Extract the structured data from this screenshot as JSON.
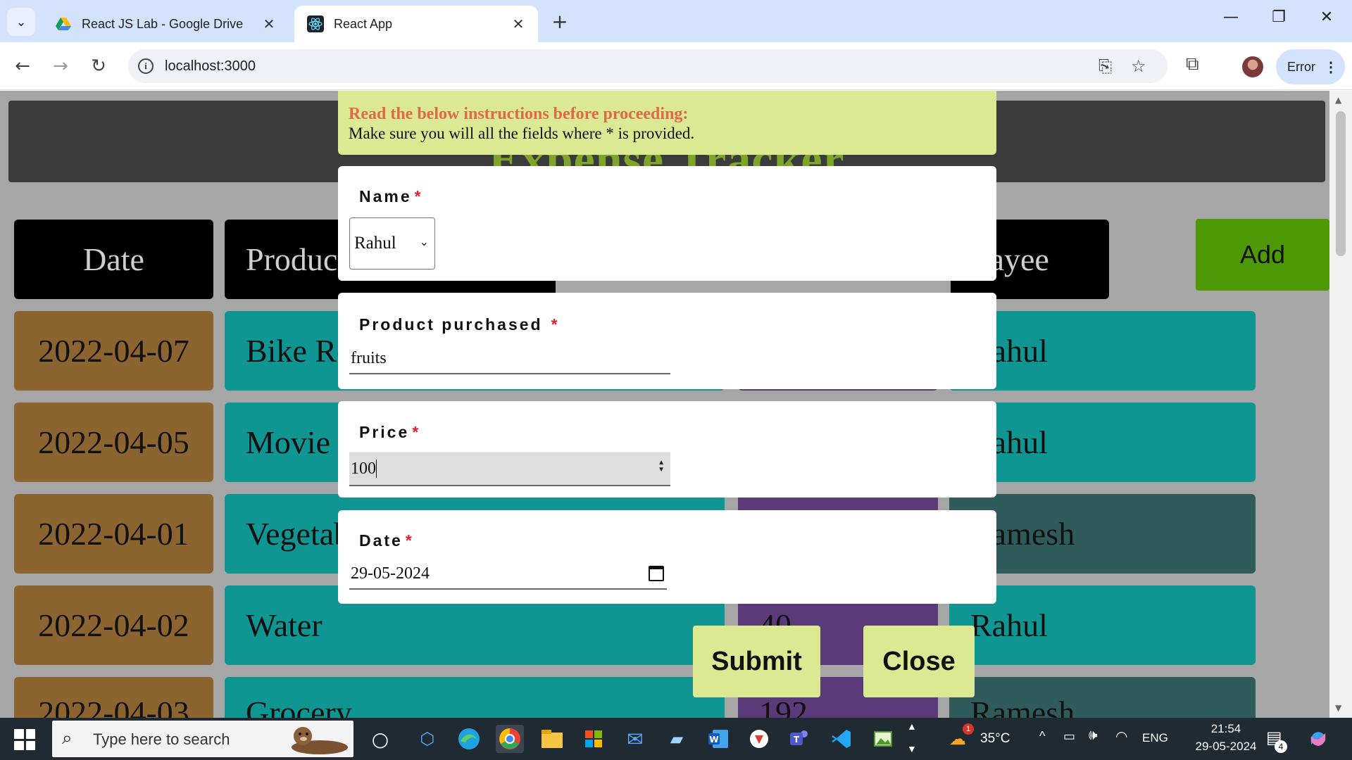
{
  "browser": {
    "tabs": [
      {
        "label": "React JS Lab - Google Drive",
        "icon": "google-drive-icon"
      },
      {
        "label": "React App",
        "icon": "react-icon"
      }
    ],
    "close_glyph": "✕",
    "newtab_glyph": "+",
    "url": "localhost:3000",
    "error_label": "Error"
  },
  "app": {
    "title": "Expense Tracker",
    "add_label": "Add",
    "headers": {
      "date": "Date",
      "product": "Product",
      "payee": "Payee"
    },
    "rows": [
      {
        "date": "2022-04-07",
        "product": "Bike Repair",
        "price": "",
        "payee": "Rahul"
      },
      {
        "date": "2022-04-05",
        "product": "Movie",
        "price": "",
        "payee": "Rahul"
      },
      {
        "date": "2022-04-01",
        "product": "Vegetables",
        "price": "",
        "payee": "Ramesh"
      },
      {
        "date": "2022-04-02",
        "product": "Water",
        "price": "40",
        "payee": "Rahul"
      },
      {
        "date": "2022-04-03",
        "product": "Grocery",
        "price": "192",
        "payee": "Ramesh"
      }
    ]
  },
  "modal": {
    "notice_title": "Read the below instructions before proceeding:",
    "notice_text": "Make sure you will all the fields where * is provided.",
    "name_label": "Name",
    "name_value": "Rahul",
    "product_label": "Product purchased",
    "product_value": "fruits",
    "price_label": "Price",
    "price_value": "100",
    "date_label": "Date",
    "date_value": "29-05-2024",
    "required_mark": "*",
    "submit_label": "Submit",
    "close_label": "Close"
  },
  "taskbar": {
    "search_placeholder": "Type here to search",
    "weather_temp": "35°C",
    "weather_badge": "1",
    "language": "ENG",
    "time": "21:54",
    "date": "29-05-2024",
    "notification_count": "4"
  },
  "colors": {
    "page_bg": "#a6a6a6",
    "title_green": "#7ca52a",
    "notice_bg": "#dce993",
    "notice_title": "#e0684b",
    "add_green": "#4e9a06",
    "date_cell": "#8c6430",
    "teal_cell": "#0f9693",
    "purple_cell": "#5a3a78"
  }
}
